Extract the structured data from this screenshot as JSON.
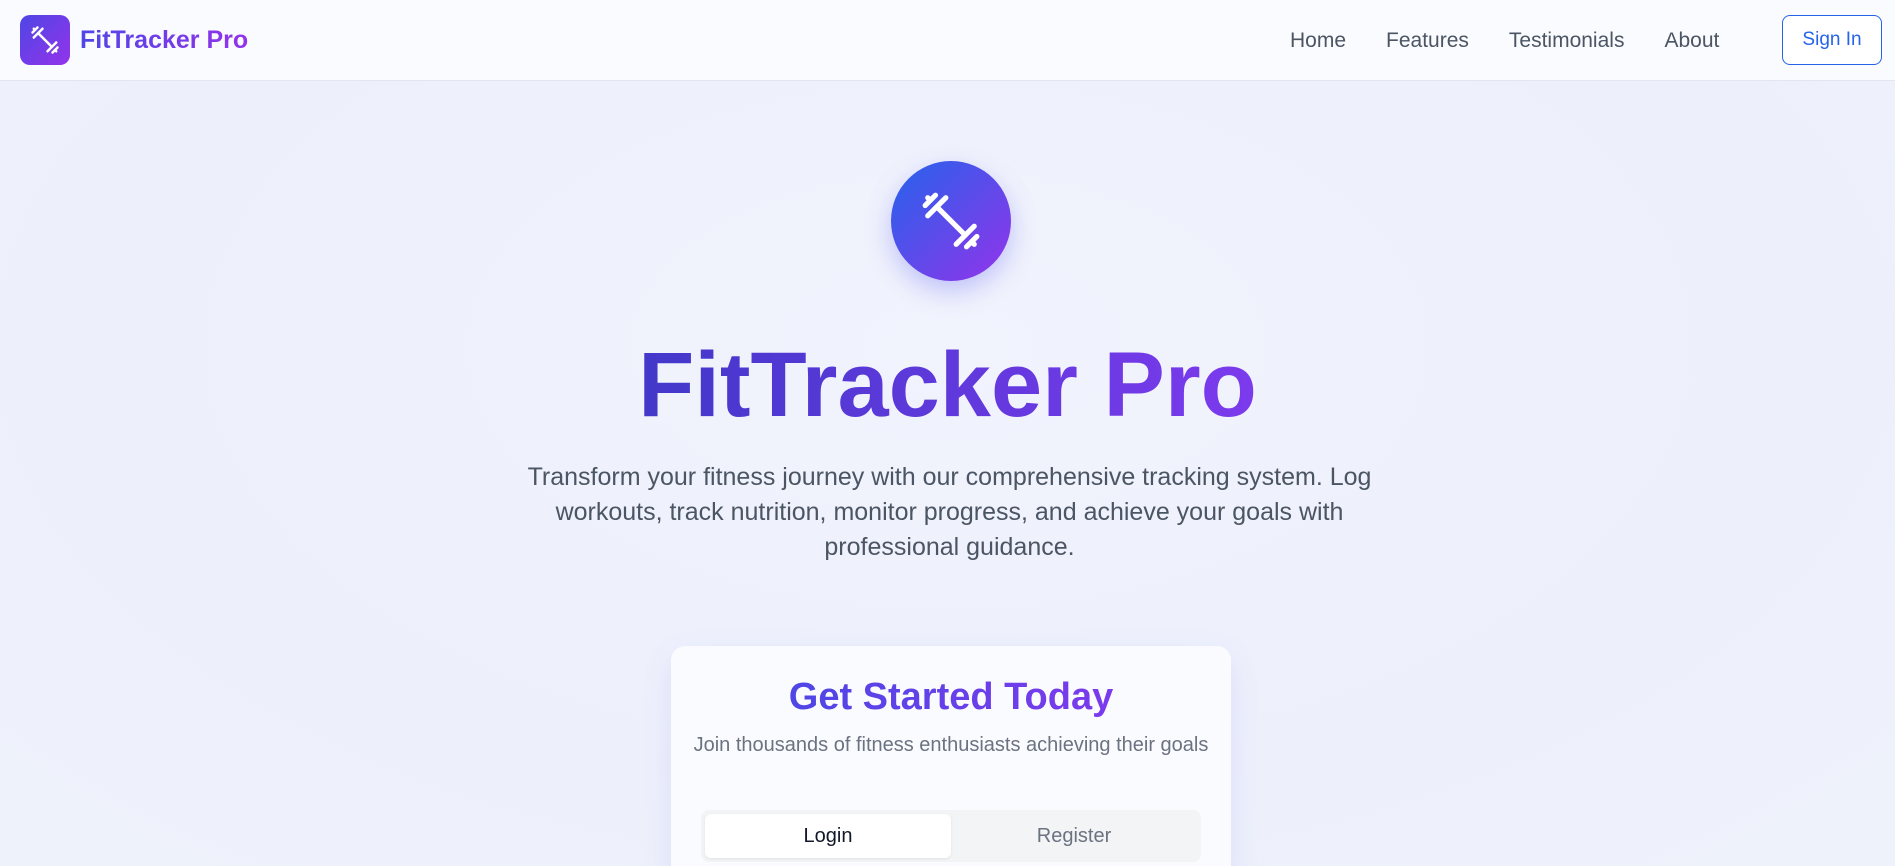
{
  "header": {
    "brand": "FitTracker Pro",
    "nav": [
      "Home",
      "Features",
      "Testimonials",
      "About"
    ],
    "signin_label": "Sign In"
  },
  "hero": {
    "title": "FitTracker Pro",
    "subtitle": "Transform your fitness journey with our comprehensive tracking system. Log workouts, track nutrition, monitor progress, and achieve your goals with professional guidance."
  },
  "card": {
    "title": "Get Started Today",
    "subtitle": "Join thousands of fitness enthusiasts achieving their goals",
    "tabs": [
      "Login",
      "Register"
    ],
    "active_tab": "Login"
  },
  "icons": {
    "brand": "dumbbell-icon",
    "hero": "dumbbell-icon"
  },
  "colors": {
    "primary": "#4f46e5",
    "secondary": "#9333ea",
    "link": "#2563eb"
  }
}
